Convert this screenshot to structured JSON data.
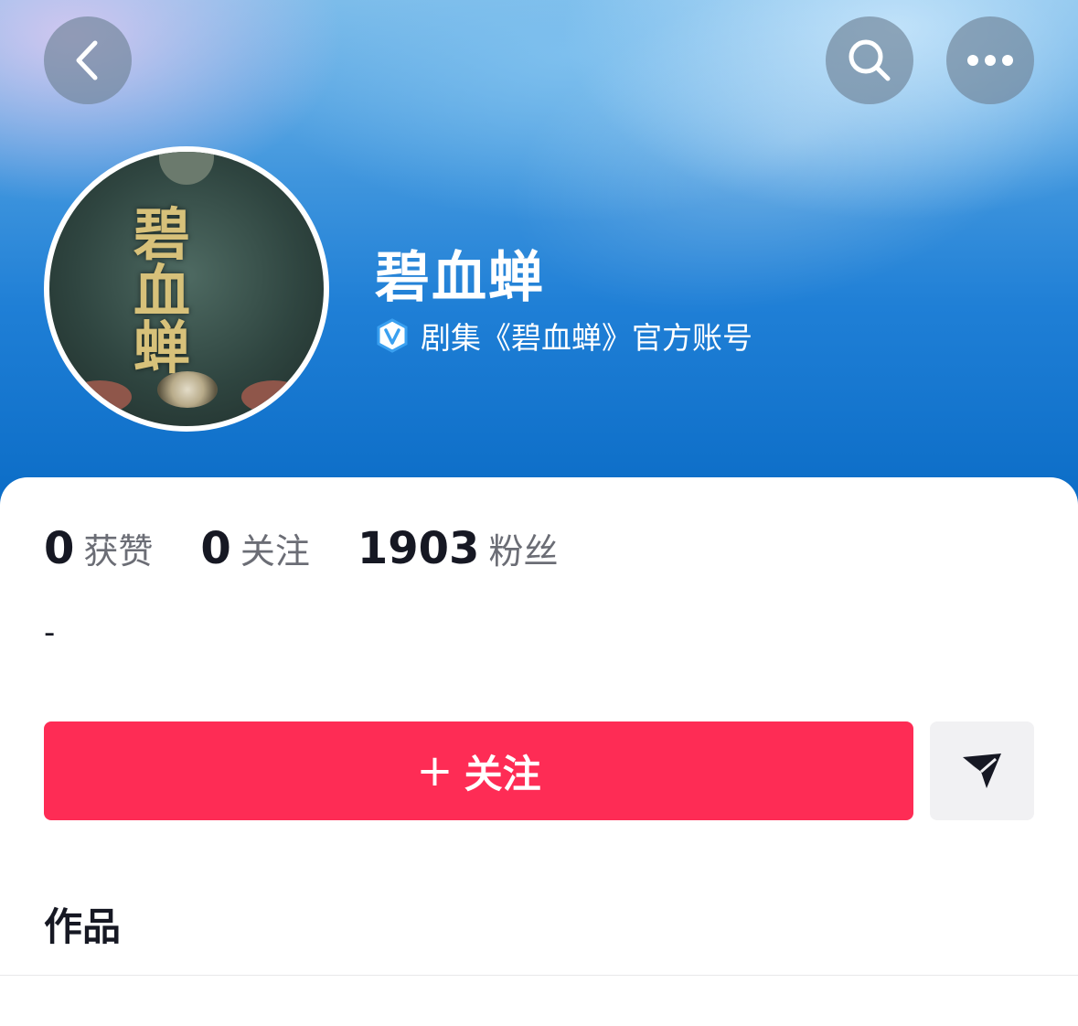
{
  "header": {
    "back_icon": "chevron-left-icon",
    "search_icon": "search-icon",
    "more_icon": "more-horizontal-icon"
  },
  "profile": {
    "avatar_text": "碧血蝉",
    "name": "碧血蝉",
    "verified_icon": "verified-v-icon",
    "verified_text": "剧集《碧血蝉》官方账号"
  },
  "stats": [
    {
      "value": "0",
      "label": "获赞"
    },
    {
      "value": "0",
      "label": "关注"
    },
    {
      "value": "1903",
      "label": "粉丝"
    }
  ],
  "bio": "-",
  "actions": {
    "follow_plus": "+",
    "follow_label": "关注",
    "share_icon": "send-icon"
  },
  "tabs": {
    "works_label": "作品"
  },
  "colors": {
    "follow_button": "#fe2c55",
    "verified_blue": "#3aa0f0"
  }
}
